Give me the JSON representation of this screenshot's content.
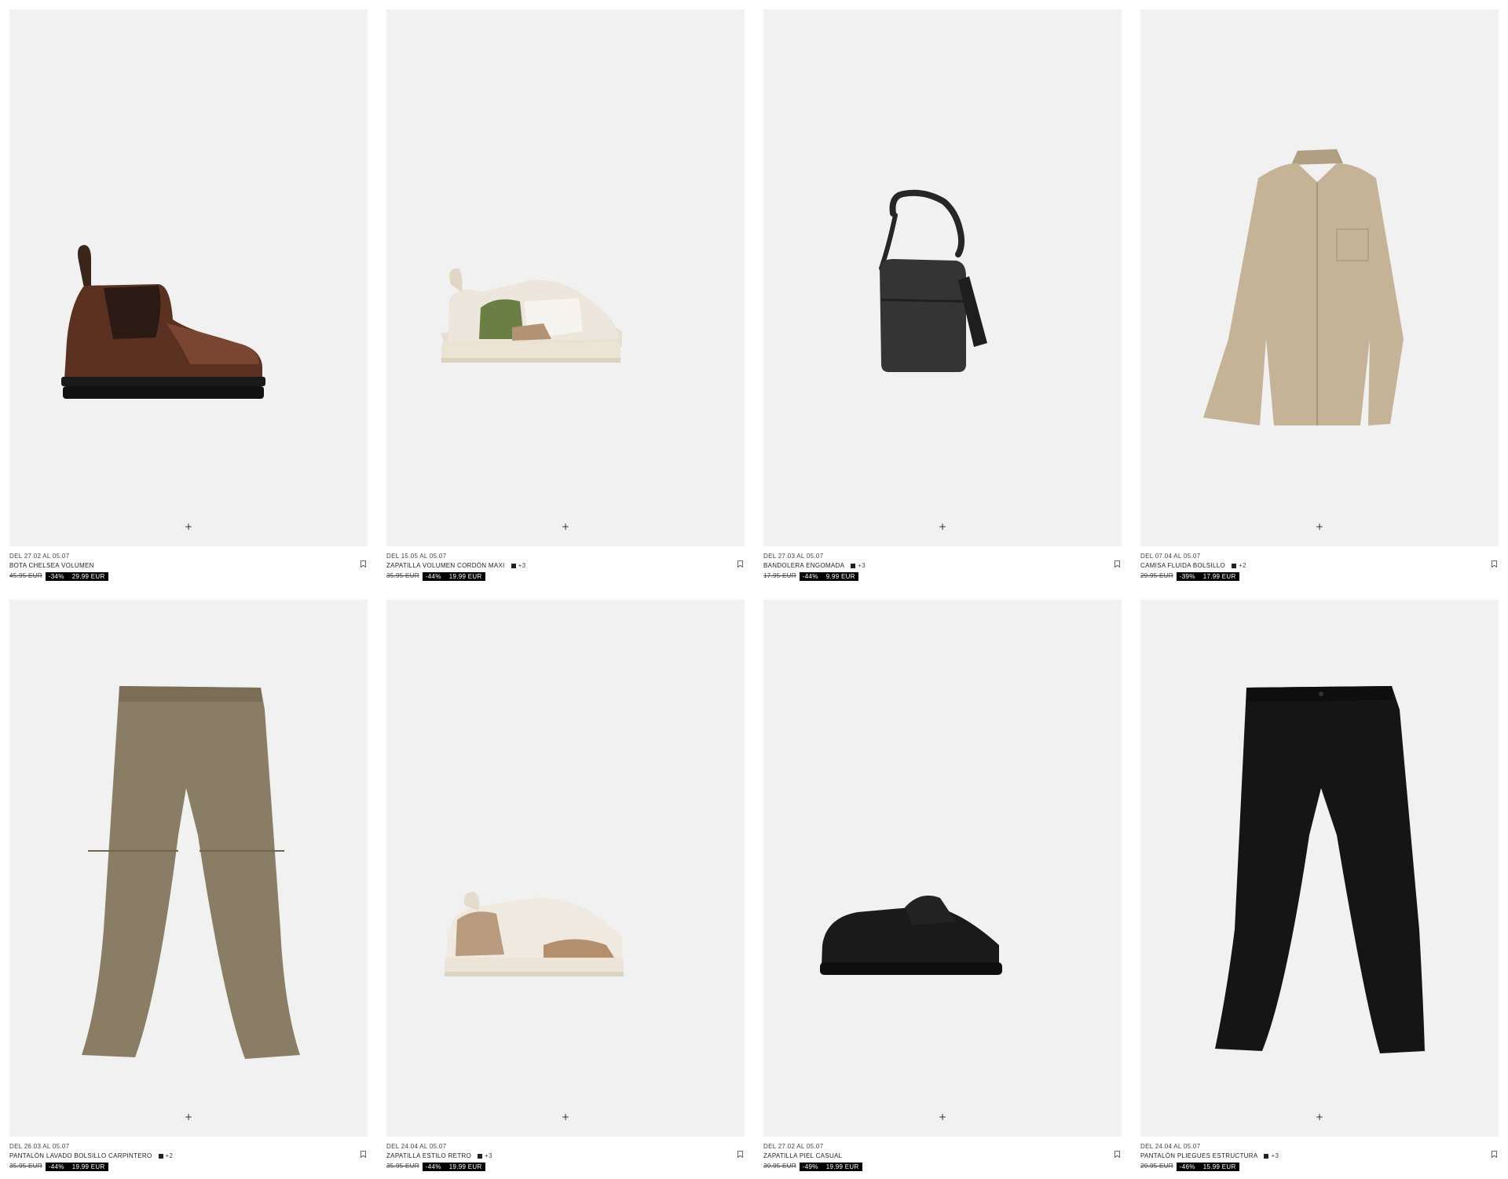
{
  "products": [
    {
      "dates": "DEL 27.02 AL 05.07",
      "name": "BOTA CHELSEA VOLUMEN",
      "colors": "",
      "old_price": "45.95 EUR",
      "discount": "-34%",
      "price": "29.99 EUR",
      "add_label": "+",
      "image": "chelsea-boot"
    },
    {
      "dates": "DEL 15.05 AL 05.07",
      "name": "ZAPATILLA VOLUMEN CORDÓN MAXI",
      "colors": "+3",
      "old_price": "35.95 EUR",
      "discount": "-44%",
      "price": "19.99 EUR",
      "add_label": "+",
      "image": "sneaker-green"
    },
    {
      "dates": "DEL 27.03 AL 05.07",
      "name": "BANDOLERA ENGOMADA",
      "colors": "+3",
      "old_price": "17.95 EUR",
      "discount": "-44%",
      "price": "9.99 EUR",
      "add_label": "+",
      "image": "crossbody-bag"
    },
    {
      "dates": "DEL 07.04 AL 05.07",
      "name": "CAMISA FLUIDA BOLSILLO",
      "colors": "+2",
      "old_price": "29.95 EUR",
      "discount": "-39%",
      "price": "17.99 EUR",
      "add_label": "+",
      "image": "beige-shirt"
    },
    {
      "dates": "DEL 26.03 AL 05.07",
      "name": "PANTALÓN LAVADO BOLSILLO CARPINTERO",
      "colors": "+2",
      "old_price": "35.95 EUR",
      "discount": "-44%",
      "price": "19.99 EUR",
      "add_label": "+",
      "image": "carpenter-pants"
    },
    {
      "dates": "DEL 24.04 AL 05.07",
      "name": "ZAPATILLA ESTILO RETRO",
      "colors": "+3",
      "old_price": "35.95 EUR",
      "discount": "-44%",
      "price": "19.99 EUR",
      "add_label": "+",
      "image": "sneaker-retro"
    },
    {
      "dates": "DEL 27.02 AL 05.07",
      "name": "ZAPATILLA PIEL CASUAL",
      "colors": "",
      "old_price": "39.95 EUR",
      "discount": "-49%",
      "price": "19.99 EUR",
      "add_label": "+",
      "image": "black-shoe"
    },
    {
      "dates": "DEL 24.04 AL 05.07",
      "name": "PANTALÓN PLIEGUES ESTRUCTURA",
      "colors": "+3",
      "old_price": "29.95 EUR",
      "discount": "-46%",
      "price": "15.99 EUR",
      "add_label": "+",
      "image": "black-trousers"
    }
  ]
}
